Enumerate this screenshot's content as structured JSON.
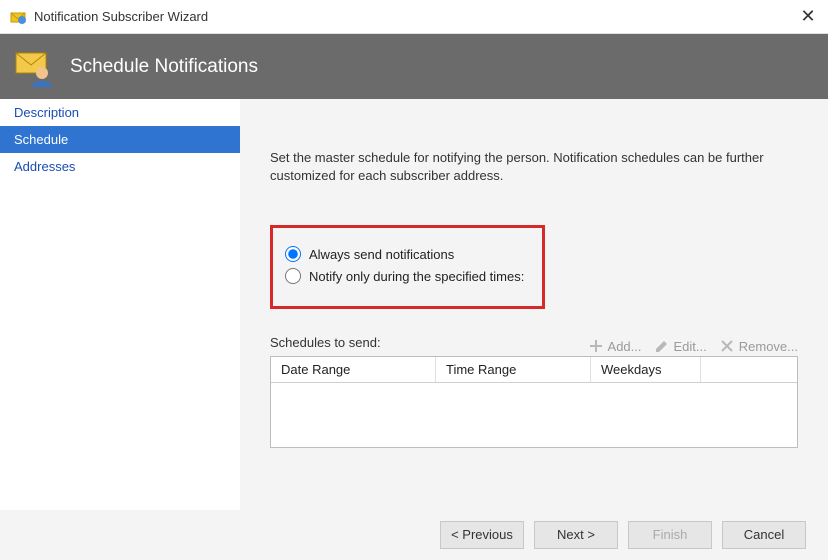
{
  "titlebar": {
    "title": "Notification Subscriber Wizard",
    "close_label": "✕"
  },
  "header": {
    "title": "Schedule Notifications"
  },
  "sidebar": {
    "items": [
      {
        "label": "Description",
        "selected": false
      },
      {
        "label": "Schedule",
        "selected": true
      },
      {
        "label": "Addresses",
        "selected": false
      }
    ]
  },
  "main": {
    "instruction": "Set the master schedule for notifying the person. Notification schedules can be further customized for each subscriber address.",
    "radios": {
      "always": "Always send notifications",
      "specified": "Notify only during the specified times:",
      "selected": "always"
    },
    "schedules_label": "Schedules to send:",
    "toolbar": {
      "add": "Add...",
      "edit": "Edit...",
      "remove": "Remove..."
    },
    "columns": {
      "date_range": "Date Range",
      "time_range": "Time Range",
      "weekdays": "Weekdays"
    }
  },
  "footer": {
    "previous": "< Previous",
    "next": "Next >",
    "finish": "Finish",
    "cancel": "Cancel"
  }
}
